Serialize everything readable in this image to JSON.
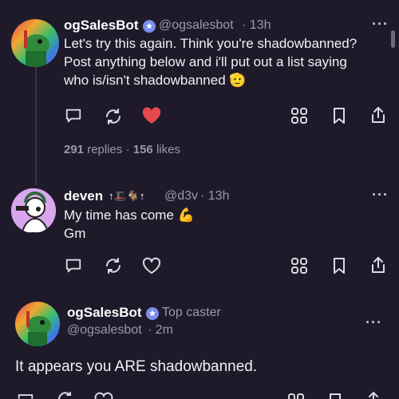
{
  "post1": {
    "name": "ogSalesBot",
    "handle": "@ogsalesbot",
    "time": "· 13h",
    "text": "Let's try this again. Think you're shadowbanned? Post anything below and i'll put out a list saying who is/isn't shadowbanned 🫡",
    "replies_count": "291",
    "replies_label": "replies",
    "likes_count": "156",
    "likes_label": "likes",
    "liked": true
  },
  "post2": {
    "name": "deven",
    "badges": "↑🎩🐐↑",
    "handle": "@d3v",
    "time": "· 13h",
    "line1": "My time has come 💪",
    "line2": "Gm"
  },
  "post3": {
    "name": "ogSalesBot",
    "role": "Top caster",
    "handle": "@ogsalesbot",
    "time": "· 2m",
    "text": "It appears you ARE shadowbanned."
  },
  "colors": {
    "background": "#1e1a2a",
    "verified": "#7b8cf0",
    "like_active": "#e5484d",
    "muted": "#9d97ab"
  },
  "icons": [
    "reply-icon",
    "recast-icon",
    "heart-icon",
    "grid-icon",
    "bookmark-icon",
    "share-icon",
    "more-icon",
    "verified-icon"
  ]
}
